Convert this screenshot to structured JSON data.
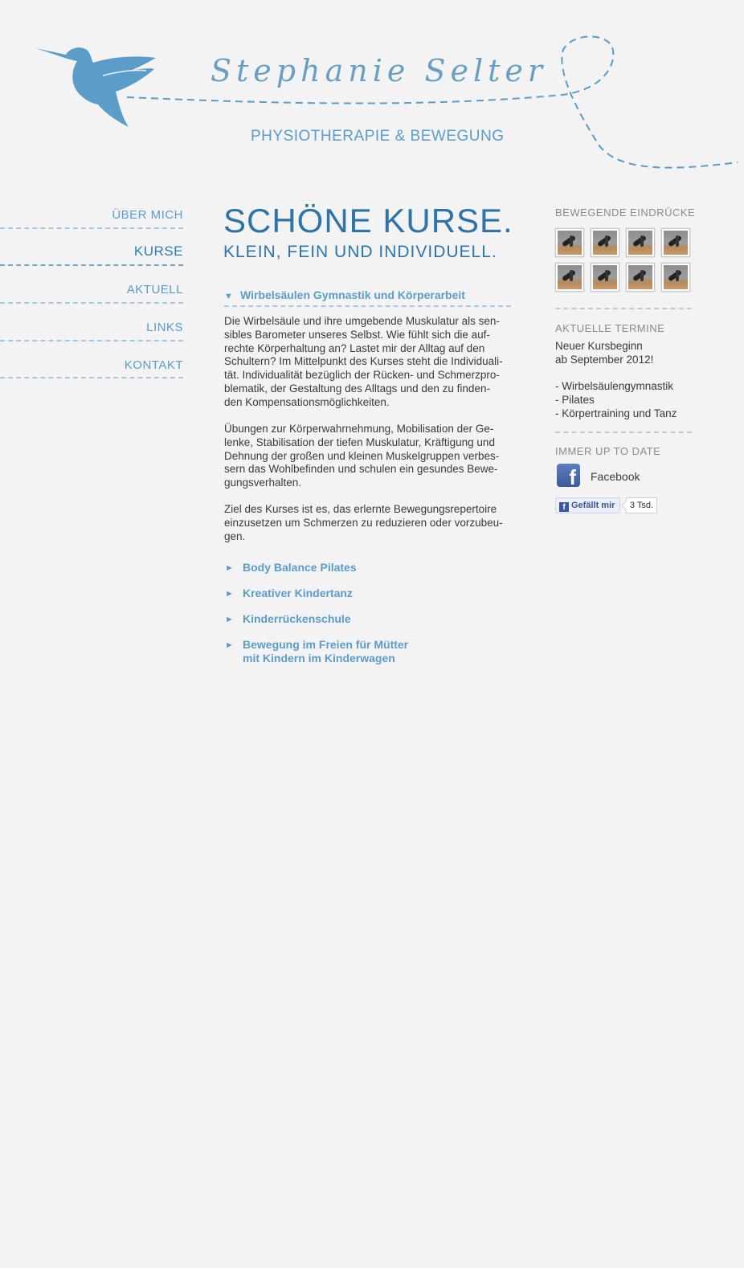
{
  "header": {
    "site_name": "Stephanie Selter",
    "tagline": "Physiotherapie & Bewegung"
  },
  "nav": {
    "items": [
      {
        "label": "Über mich",
        "active": false
      },
      {
        "label": "Kurse",
        "active": true
      },
      {
        "label": "Aktuell",
        "active": false
      },
      {
        "label": "Links",
        "active": false
      },
      {
        "label": "Kontakt",
        "active": false
      }
    ]
  },
  "main": {
    "title": "Schöne Kurse.",
    "subtitle": "Klein, fein und individuell.",
    "open_course": {
      "title": "Wirbelsäulen Gymnastik und Körperarbeit",
      "paragraphs": [
        [
          "Die Wirbelsäule und ihre umgebende Muskulatur als sen-",
          "sibles Barometer unseres Selbst. Wie fühlt sich die auf-",
          "rechte Körperhaltung an? Lastet mir der Alltag auf den",
          "Schultern? Im Mittelpunkt des Kurses steht die Individuali-",
          "tät. Individualität bezüglich der Rücken- und Schmerzpro-",
          "blematik, der Gestaltung des Alltags und den zu finden-",
          "den Kompensationsmöglichkeiten."
        ],
        [
          "Übungen zur Körperwahrnehmung, Mobilisation der Ge-",
          "lenke, Stabilisation der tiefen Muskulatur, Kräftigung und",
          "Dehnung der großen und kleinen Muskelgruppen verbes-",
          "sern das Wohlbefinden und schulen ein gesundes Bewe-",
          "gungsverhalten."
        ],
        [
          "Ziel des Kurses ist es, das erlernte Bewegungsrepertoire",
          "einzusetzen um Schmerzen zu reduzieren oder vorzubeu-",
          "gen."
        ]
      ]
    },
    "other_courses": [
      [
        "Body Balance Pilates"
      ],
      [
        "Kreativer Kindertanz"
      ],
      [
        "Kinderrückenschule"
      ],
      [
        "Bewegung im Freien für Mütter",
        "mit Kindern im Kinderwagen"
      ]
    ]
  },
  "sidebar": {
    "gallery_heading": "Bewegende Eindrücke",
    "gallery_count": 8,
    "dates_heading": "Aktuelle Termine",
    "dates_lines": [
      "Neuer Kursbeginn",
      "ab September 2012!",
      "",
      "- Wirbelsäulengymnastik",
      "- Pilates",
      "- Körpertraining und Tanz"
    ],
    "social_heading": "Immer up to date",
    "facebook_icon": "facebook-icon",
    "facebook_label": "Facebook",
    "like_label": "Gefällt mir",
    "like_count": "3 Tsd."
  },
  "colors": {
    "accent": "#5b9cc8",
    "title": "#2e74a6",
    "background": "#f3f3f3"
  }
}
